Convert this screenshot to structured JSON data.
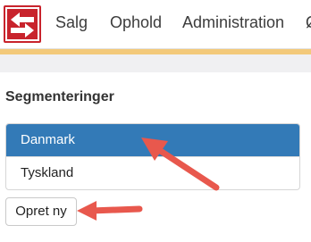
{
  "nav": {
    "logo_icon": "swap-arrows-icon",
    "items": [
      {
        "label": "Salg"
      },
      {
        "label": "Ophold"
      },
      {
        "label": "Administration"
      }
    ],
    "cut_item": "Ø"
  },
  "section": {
    "title": "Segmenteringer",
    "items": [
      {
        "label": "Danmark",
        "active": true
      },
      {
        "label": "Tyskland",
        "active": false
      }
    ],
    "create_button": "Opret ny"
  },
  "colors": {
    "brand_red": "#c8232c",
    "active_blue": "#337ab7",
    "accent_stripe": "#f3c97a",
    "annotation_arrow": "#e8584d"
  }
}
